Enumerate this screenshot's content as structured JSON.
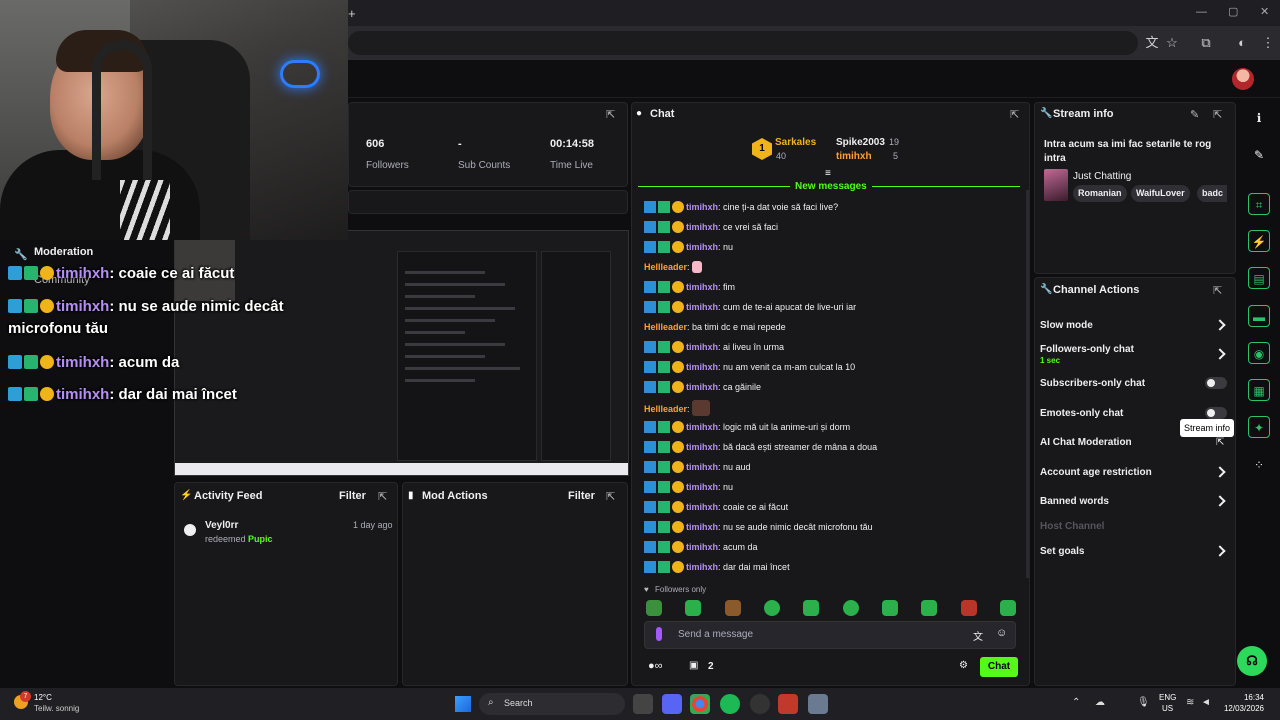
{
  "overlay": {
    "moderation_title": "Moderation",
    "community_label": "Community",
    "lines": [
      {
        "user": "timihxh",
        "text": "coaie ce ai făcut"
      },
      {
        "user": "timihxh",
        "text": "nu se aude nimic decât microfonu tău"
      },
      {
        "user": "timihxh",
        "text": "acum da"
      },
      {
        "user": "timihxh",
        "text": "dar dai mai încet"
      }
    ]
  },
  "stats": {
    "followers_value": "606",
    "followers_label": "Followers",
    "subs_value": "-",
    "subs_label": "Sub Counts",
    "time_value": "00:14:58",
    "time_label": "Time Live"
  },
  "activity": {
    "title": "Activity Feed",
    "filter": "Filter",
    "item_user": "Veyl0rr",
    "item_time": "1 day ago",
    "item_action": "redeemed",
    "item_reward": "Pupic"
  },
  "mod_actions": {
    "title": "Mod Actions",
    "filter": "Filter"
  },
  "chat": {
    "title": "Chat",
    "leader1_name": "Sarkales",
    "leader1_points": "40",
    "leader2_name": "Spike2003",
    "leader2_points": "19",
    "leader3_name": "timihxh",
    "leader3_points": "5",
    "new_messages": "New messages",
    "messages": [
      {
        "user": "timihxh",
        "text": "cine ți-a dat voie să faci live?",
        "type": "sub"
      },
      {
        "user": "timihxh",
        "text": "ce vrei să faci",
        "type": "sub"
      },
      {
        "user": "timihxh",
        "text": "nu",
        "type": "sub"
      },
      {
        "user": "Hellleader",
        "text": "",
        "type": "lead"
      },
      {
        "user": "timihxh",
        "text": "fim",
        "type": "sub"
      },
      {
        "user": "timihxh",
        "text": "cum de te-ai apucat de live-uri iar",
        "type": "sub"
      },
      {
        "user": "Hellleader",
        "text": "ba timi dc e mai repede",
        "type": "lead"
      },
      {
        "user": "timihxh",
        "text": "ai liveu în urma",
        "type": "sub"
      },
      {
        "user": "timihxh",
        "text": "nu am venit ca m-am culcat la 10",
        "type": "sub"
      },
      {
        "user": "timihxh",
        "text": "ca găinile",
        "type": "sub"
      },
      {
        "user": "Hellleader",
        "text": "",
        "type": "lead"
      },
      {
        "user": "timihxh",
        "text": "logic mă uit la anime-uri și dorm",
        "type": "sub"
      },
      {
        "user": "timihxh",
        "text": "bă dacă ești streamer de mâna a doua",
        "type": "sub"
      },
      {
        "user": "timihxh",
        "text": "nu aud",
        "type": "sub"
      },
      {
        "user": "timihxh",
        "text": "nu",
        "type": "sub"
      },
      {
        "user": "timihxh",
        "text": "coaie ce ai făcut",
        "type": "sub"
      },
      {
        "user": "timihxh",
        "text": "nu se aude nimic decât microfonu tău",
        "type": "sub"
      },
      {
        "user": "timihxh",
        "text": "acum da",
        "type": "sub"
      },
      {
        "user": "timihxh",
        "text": "dar dai mai încet",
        "type": "sub"
      }
    ],
    "followers_only": "Followers only",
    "placeholder": "Send a message",
    "viewer_count": "2",
    "chat_button": "Chat"
  },
  "stream_info": {
    "title": "Stream info",
    "stream_title": "Intra acum sa imi fac setarile te rog intra",
    "category": "Just Chatting",
    "tags": [
      "Romanian",
      "WaifuLover",
      "badc"
    ]
  },
  "channel_actions": {
    "title": "Channel Actions",
    "slow_mode": "Slow mode",
    "followers_only": "Followers-only chat",
    "followers_only_sub": "1 sec",
    "subscribers_only": "Subscribers-only chat",
    "emotes_only": "Emotes-only chat",
    "ai_moderation": "AI Chat Moderation",
    "account_age": "Account age restriction",
    "banned_words": "Banned words",
    "host_channel": "Host Channel",
    "set_goals": "Set goals"
  },
  "tooltip": "Stream info",
  "taskbar": {
    "weather_temp": "12°C",
    "weather_desc": "Teilw. sonnig",
    "weather_badge": "7",
    "search": "Search",
    "lang": "ENG",
    "region": "US",
    "time": "16:34",
    "date": "12/03/2026"
  },
  "colors": {
    "accent": "#53fc18",
    "purple_name": "#b58ff5",
    "orange_name": "#ff9f3a"
  }
}
